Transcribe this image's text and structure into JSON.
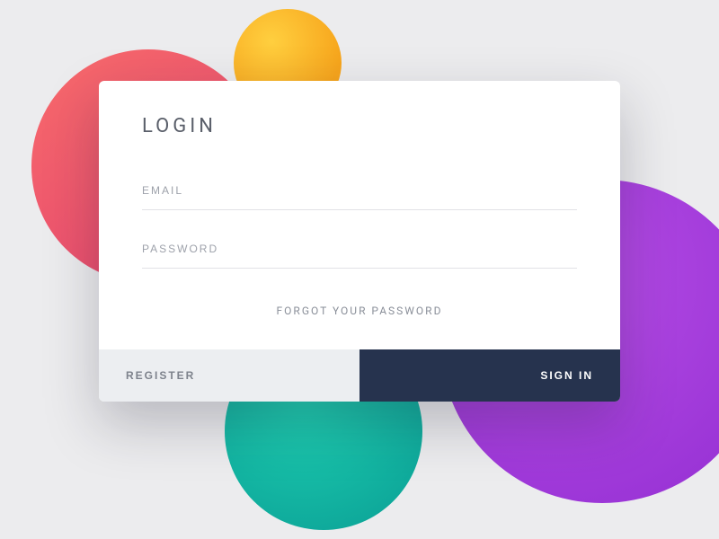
{
  "title": "LOGIN",
  "fields": {
    "email": {
      "placeholder": "EMAIL",
      "value": ""
    },
    "password": {
      "placeholder": "PASSWORD",
      "value": ""
    }
  },
  "links": {
    "forgot": "FORGOT YOUR PASSWORD"
  },
  "buttons": {
    "register": "REGISTER",
    "signin": "SIGN IN"
  },
  "colors": {
    "card_bg": "#ffffff",
    "page_bg": "#ececee",
    "primary_button_bg": "#26334e",
    "secondary_button_bg": "#eceef1",
    "circle_red": "#e84a6f",
    "circle_orange": "#f7a51c",
    "circle_teal": "#0ea89a",
    "circle_purple": "#9a34d6"
  }
}
